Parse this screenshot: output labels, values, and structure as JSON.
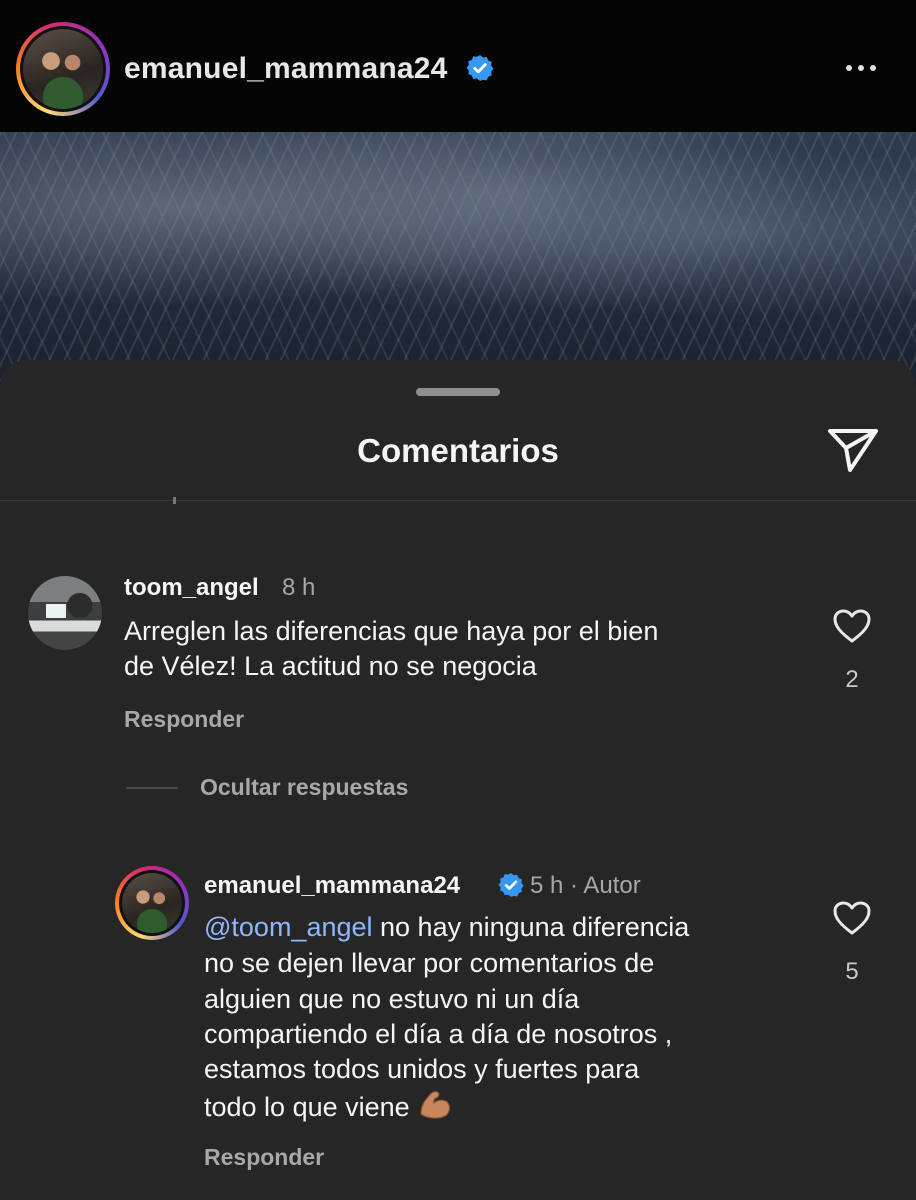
{
  "post": {
    "username": "emanuel_mammana24",
    "verified": true
  },
  "comments_sheet": {
    "title": "Comentarios"
  },
  "comments": [
    {
      "username": "toom_angel",
      "time": "8 h",
      "text_line1": "Arreglen las diferencias que haya por el bien",
      "text_line2": "de Vélez! La actitud no se negocia",
      "likes": "2",
      "reply_label": "Responder"
    }
  ],
  "hide_replies_label": "Ocultar respuestas",
  "reply": {
    "username": "emanuel_mammana24",
    "time": "5 h",
    "separator": "·",
    "author_badge": "Autor",
    "mention": "@toom_angel",
    "text_line1": " no hay ninguna diferencia",
    "text_line2": "no se dejen llevar por comentarios de",
    "text_line3": "alguien que no estuvo ni un día",
    "text_line4": "compartiendo el día a día de nosotros ,",
    "text_line5": "estamos todos unidos y fuertes para",
    "text_line6": "todo lo que viene",
    "emoji": "flexed-biceps",
    "likes": "5",
    "reply_label": "Responder"
  },
  "colors": {
    "sheet_bg": "#262626",
    "mention": "#8fb6ff",
    "verified_blue": "#3897f0",
    "muted_text": "#a8a8a8"
  }
}
